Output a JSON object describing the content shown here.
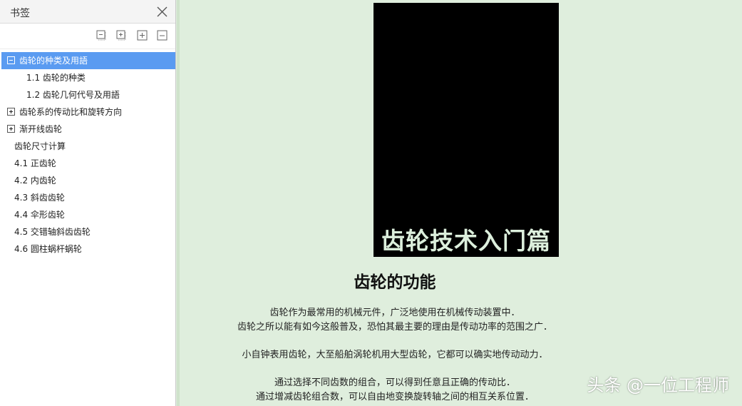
{
  "panel": {
    "title": "书签",
    "items": [
      {
        "label": "齿轮的种类及用語",
        "level": 0,
        "expander": "minus",
        "selected": true
      },
      {
        "label": "1.1 齿轮的种类",
        "level": 1
      },
      {
        "label": "1.2 齿轮几何代号及用語",
        "level": 1
      },
      {
        "label": "齿轮系的传动比和旋转方向",
        "level": 0,
        "expander": "plus"
      },
      {
        "label": "渐开线齿轮",
        "level": 0,
        "expander": "plus"
      },
      {
        "label": "齿轮尺寸计算",
        "level": 0
      },
      {
        "label": "4.1 正齿轮",
        "level": 0
      },
      {
        "label": "4.2 内齿轮",
        "level": 0
      },
      {
        "label": "4.3 斜齿齿轮",
        "level": 0
      },
      {
        "label": "4.4 伞形齿轮",
        "level": 0
      },
      {
        "label": "4.5 交错轴斜齿齿轮",
        "level": 0
      },
      {
        "label": "4.6 圆柱蜗杆蜗轮",
        "level": 0
      }
    ],
    "icons": [
      "collapse-all-icon",
      "expand-all-icon",
      "expand-bookmark-icon",
      "bookmark-icon",
      "close-icon"
    ]
  },
  "doc": {
    "cover_title": "齿轮技术入门篇",
    "heading": "齿轮的功能",
    "paragraphs": [
      "齿轮作为最常用的机械元件，广泛地使用在机械传动装置中．",
      "齿轮之所以能有如今这般普及，恐怕其最主要的理由是传动功率的范围之广．",
      "小自钟表用齿轮，大至船舶涡轮机用大型齿轮，它都可以确实地传动动力．",
      "通过选择不同齿数的组合，可以得到任意且正确的传动比．",
      "通过增减齿轮组合数，可以自由地变换旋转轴之间的相互关系位置．"
    ]
  },
  "watermark": "头条 @一位工程师",
  "colors": {
    "selection": "#5a9bf1",
    "doc_background": "#dfeedd",
    "cover": "#000000"
  }
}
